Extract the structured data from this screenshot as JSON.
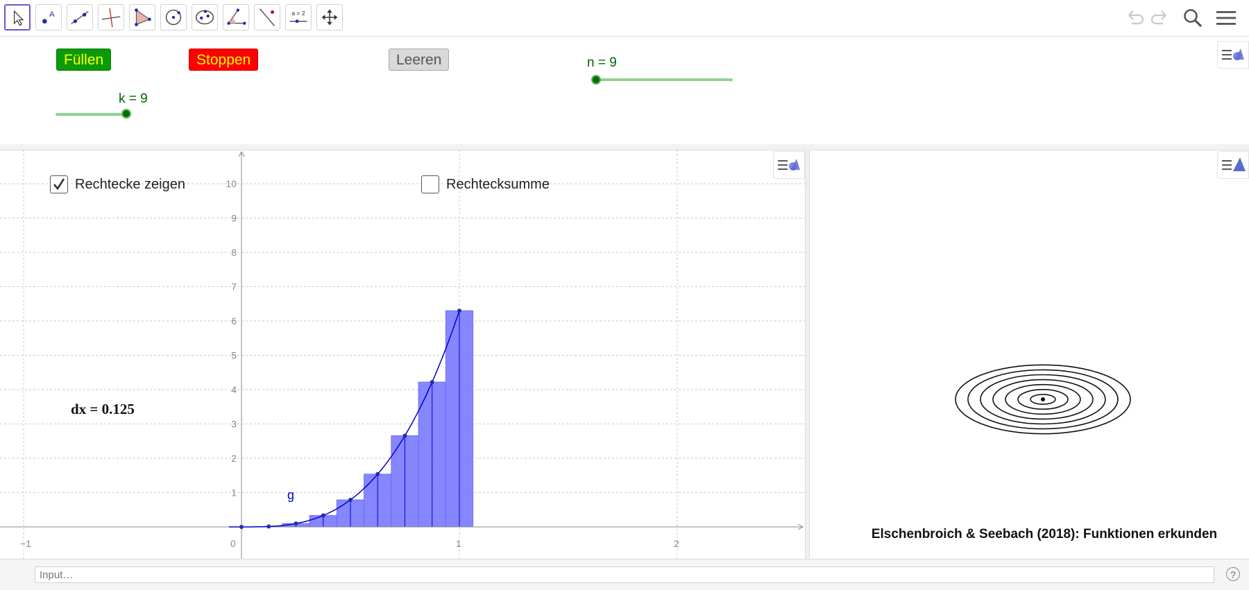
{
  "toolbar": {
    "tools": [
      {
        "name": "move-tool-icon"
      },
      {
        "name": "point-tool-icon"
      },
      {
        "name": "line-tool-icon"
      },
      {
        "name": "perpendicular-tool-icon"
      },
      {
        "name": "polygon-tool-icon"
      },
      {
        "name": "circle-tool-icon"
      },
      {
        "name": "ellipse-tool-icon"
      },
      {
        "name": "angle-tool-icon"
      },
      {
        "name": "reflect-tool-icon"
      },
      {
        "name": "slider-tool-icon",
        "label": "a = 2"
      },
      {
        "name": "move-view-tool-icon"
      }
    ],
    "right": [
      "undo-icon",
      "redo-icon",
      "search-icon",
      "menu-icon"
    ]
  },
  "buttons": {
    "fill": "Füllen",
    "stop": "Stoppen",
    "clear": "Leeren"
  },
  "sliders": {
    "k": {
      "label": "k = 9",
      "value": 9,
      "min": 0,
      "max": 9
    },
    "n": {
      "label": "n = 9"
    }
  },
  "checkboxes": {
    "show_rects": {
      "label": "Rechtecke zeigen",
      "checked": true
    },
    "rect_sum": {
      "label": "Rechtecksumme",
      "checked": false
    }
  },
  "graph": {
    "dx_label": "dx = 0.125",
    "function_label": "g",
    "x_ticks": [
      "−1",
      "0",
      "1",
      "2"
    ],
    "y_ticks": [
      "1",
      "2",
      "3",
      "4",
      "5",
      "6",
      "7",
      "8",
      "9",
      "10"
    ],
    "rect_color": "#8080ff",
    "curve_color": "#0000cc",
    "rect_count": 9
  },
  "graphics2": {
    "credit": "Elschenbroich & Seebach (2018): Funktionen erkunden"
  },
  "input": {
    "placeholder": "Input…",
    "help": "?"
  }
}
